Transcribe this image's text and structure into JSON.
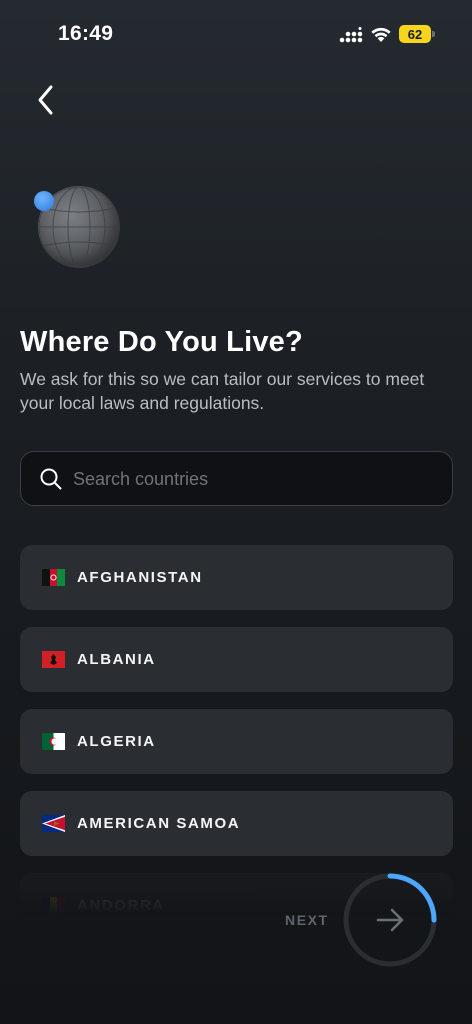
{
  "status_bar": {
    "time": "16:49",
    "battery_level": "62",
    "signal_icon": "signal-bars-icon",
    "wifi_icon": "wifi-icon"
  },
  "header": {
    "back_icon": "chevron-left-icon"
  },
  "hero": {
    "title": "Where Do You Live?",
    "subtitle": "We ask for this so we can tailor our services to meet your local laws and regulations."
  },
  "search": {
    "placeholder": "Search countries",
    "value": ""
  },
  "countries": [
    {
      "label": "AFGHANISTAN",
      "flag": "afghanistan-flag-icon"
    },
    {
      "label": "ALBANIA",
      "flag": "albania-flag-icon"
    },
    {
      "label": "ALGERIA",
      "flag": "algeria-flag-icon"
    },
    {
      "label": "AMERICAN SAMOA",
      "flag": "american-samoa-flag-icon"
    },
    {
      "label": "ANDORRA",
      "flag": "andorra-flag-icon"
    }
  ],
  "footer": {
    "next_label": "NEXT",
    "progress": 0.25
  },
  "colors": {
    "accent": "#4da6ff",
    "battery": "#f7d51d",
    "card": "#2a2e33"
  }
}
